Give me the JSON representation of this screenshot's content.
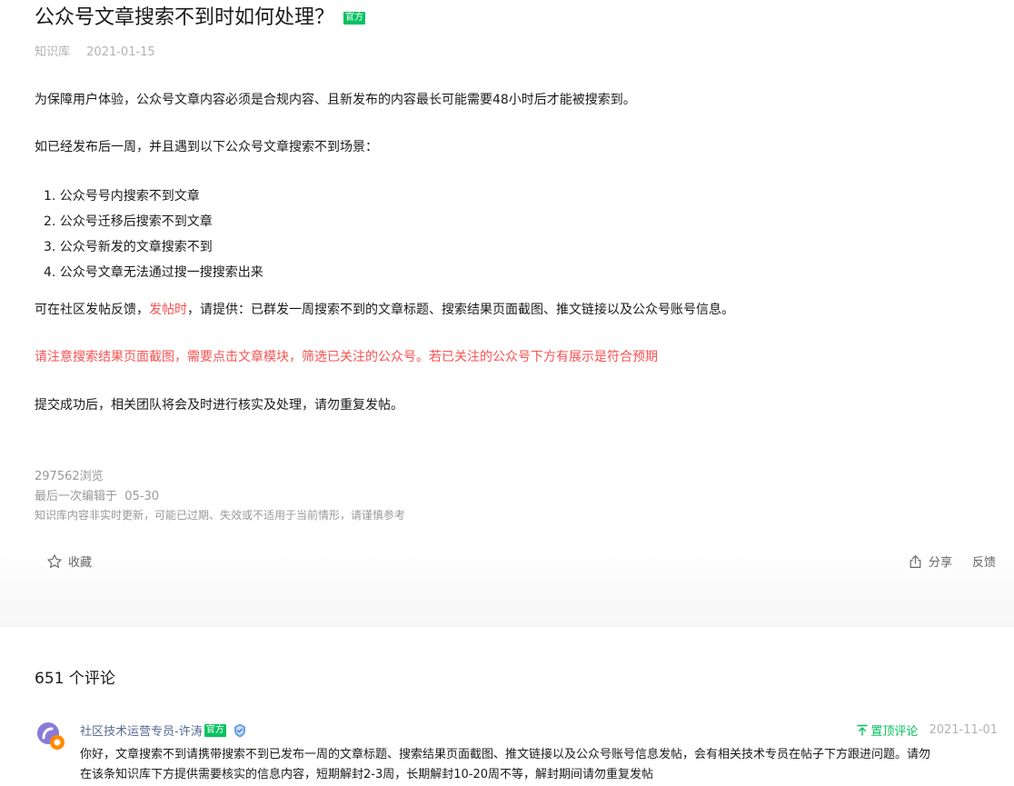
{
  "article": {
    "title": "公众号文章搜索不到时如何处理？",
    "badge": "官方",
    "source": "知识库",
    "date": "2021-01-15",
    "p1": "为保障用户体验，公众号文章内容必须是合规内容、且新发布的内容最长可能需要48小时后才能被搜索到。",
    "p2": "如已经发布后一周，并且遇到以下公众号文章搜索不到场景：",
    "list": [
      "1. 公众号号内搜索不到文章",
      "2. 公众号迁移后搜索不到文章",
      "3. 公众号新发的文章搜索不到",
      "4. 公众号文章无法通过搜一搜搜索出来"
    ],
    "p3_pre": "可在社区发帖反馈，",
    "p3_red": "发帖时",
    "p3_post": "，请提供：已群发一周搜索不到的文章标题、搜索结果页面截图、推文链接以及公众号账号信息。",
    "p4_red": "请注意搜索结果页面截图，需要点击文章模块，筛选已关注的公众号。若已关注的公众号下方有展示是符合预期",
    "p5": "提交成功后，相关团队将会及时进行核实及处理，请勿重复发帖。",
    "views": "297562浏览",
    "last_edit_label": "最后一次编辑于",
    "last_edit_date": "05-30",
    "disclaimer": "知识库内容非实时更新，可能已过期、失效或不适用于当前情形，请谨慎参考"
  },
  "actions": {
    "collect": "收藏",
    "share": "分享",
    "feedback": "反馈"
  },
  "comments": {
    "count_title": "651 个评论",
    "items": [
      {
        "author": "社区技术运营专员-许涛",
        "badge": "官方",
        "pinned_label": "置顶评论",
        "date": "2021-11-01",
        "line1": "你好，文章搜索不到请携带搜索不到已发布一周的文章标题、搜索结果页面截图、推文链接以及公众号账号信息发帖，会有相关技术专员在帖子下方跟进问题。请勿",
        "line2": "在该条知识库下方提供需要核实的信息内容，短期解封2-3周，长期解封10-20周不等，解封期间请勿重复发帖"
      }
    ]
  },
  "colors": {
    "accent_green": "#07c160",
    "red": "#fa5151",
    "link": "#576b95"
  }
}
